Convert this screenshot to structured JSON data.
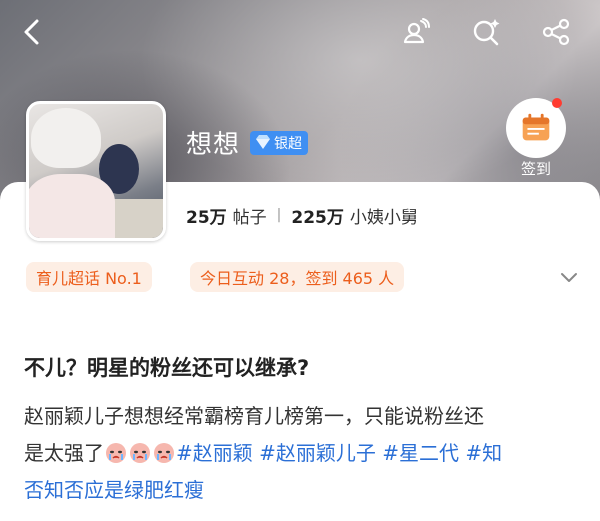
{
  "header": {
    "back_icon": "back-arrow-icon",
    "actions": [
      "user-group-icon",
      "search-sparkle-icon",
      "share-icon"
    ]
  },
  "profile": {
    "name": "想想",
    "badge": "银超",
    "posts_count": "25万",
    "posts_label": "帖子",
    "followers_count": "225万",
    "followers_label": "小姨小舅",
    "checkin_label": "签到"
  },
  "tags": {
    "rank": "育儿超话 No.1",
    "activity": "今日互动 28，签到 465 人"
  },
  "post": {
    "title": "不儿？明星的粉丝还可以继承?",
    "line1": "赵丽颖儿子想想经常霸榜育儿榜第一，只能说粉丝还",
    "line2_prefix": "是太强了",
    "hashtags": [
      "#赵丽颖",
      "#赵丽颖儿子",
      "#星二代",
      "#知"
    ],
    "line3": "否知否应是绿肥红瘦"
  },
  "colors": {
    "accent_orange": "#ec5e1c",
    "tag_bg": "#fdeee4",
    "link_blue": "#2b6fd6",
    "badge_blue": "#3f8ff2"
  }
}
